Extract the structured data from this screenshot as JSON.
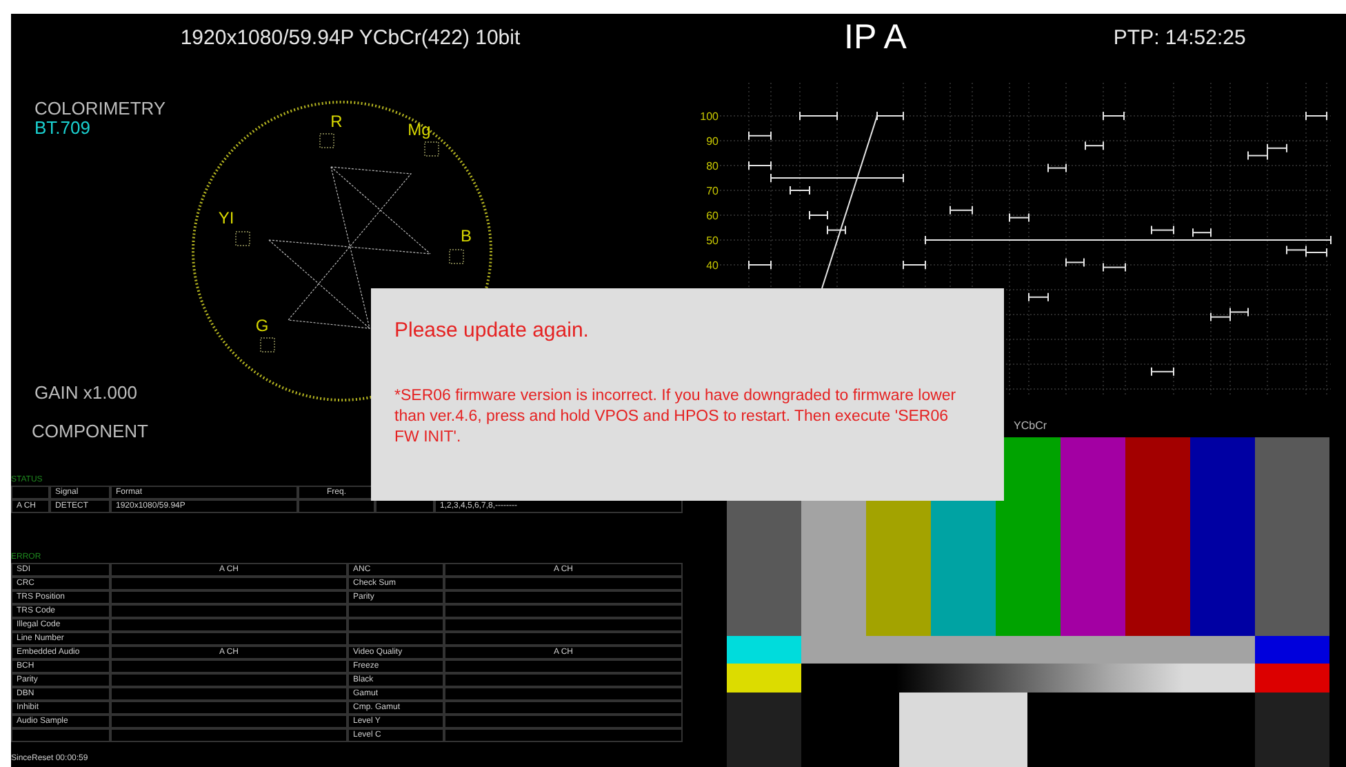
{
  "header": {
    "format": "1920x1080/59.94P YCbCr(422) 10bit",
    "input": "IP A",
    "ptp": "PTP: 14:52:25"
  },
  "vectorscope": {
    "colorimetry_label": "COLORIMETRY",
    "colorimetry": "BT.709",
    "gain": "GAIN x1.000",
    "mode": "COMPONENT",
    "targets": [
      {
        "label": "R"
      },
      {
        "label": "Mg"
      },
      {
        "label": "YI"
      },
      {
        "label": "B"
      },
      {
        "label": "G"
      }
    ]
  },
  "waveform": {
    "scale": [
      "100",
      "90",
      "80",
      "70",
      "60",
      "50",
      "40"
    ]
  },
  "status": {
    "title": "STATUS",
    "columns": [
      {
        "label": "Signal"
      },
      {
        "label": "Format"
      },
      {
        "label": "Freq."
      }
    ],
    "rows": [
      {
        "channel": "A CH",
        "signal": "DETECT",
        "format": "1920x1080/59.94P",
        "column_6": "1,2,3,4,5,6,7,8,--------"
      }
    ]
  },
  "error": {
    "title": "ERROR",
    "groups": [
      {
        "left": {
          "heading": "SDI",
          "channel": "A CH",
          "items": [
            "CRC",
            "TRS Position",
            "TRS Code",
            "Illegal Code",
            "Line Number"
          ]
        },
        "right": {
          "heading": "ANC",
          "channel": "A CH",
          "items": [
            "Check Sum",
            "Parity"
          ]
        }
      },
      {
        "left": {
          "heading": "Embedded Audio",
          "channel": "A CH",
          "items": [
            "BCH",
            "Parity",
            "DBN",
            "Inhibit",
            "Audio Sample"
          ]
        },
        "right": {
          "heading": "Video Quality",
          "channel": "A CH",
          "items": [
            "Freeze",
            "Black",
            "Gamut",
            "Cmp. Gamut",
            "Level Y",
            "Level C"
          ]
        }
      }
    ]
  },
  "since_reset": "SinceReset 00:00:59",
  "color_bars": {
    "label": "YCbCr"
  },
  "dialog": {
    "title": "Please update again.",
    "message": "*SER06 firmware version is incorrect. If you have downgraded to firmware lower than ver.4.6, press and hold VPOS and HPOS to restart. Then execute 'SER06 FW INIT'."
  }
}
